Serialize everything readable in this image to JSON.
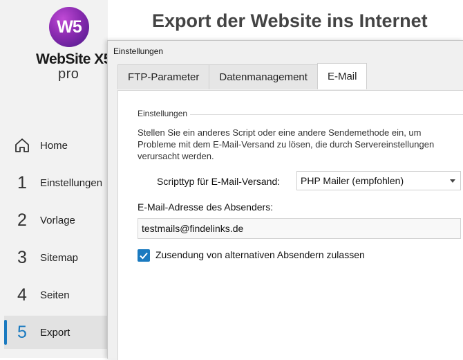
{
  "app": {
    "logo_mark": "W5",
    "logo_name": "WebSite X5",
    "logo_edition": "pro",
    "page_title": "Export der Website ins Internet",
    "accent_color": "#1a7ac0"
  },
  "sidebar": {
    "items": [
      {
        "num": "",
        "label": "Home",
        "icon": "home-icon"
      },
      {
        "num": "1",
        "label": "Einstellungen"
      },
      {
        "num": "2",
        "label": "Vorlage"
      },
      {
        "num": "3",
        "label": "Sitemap"
      },
      {
        "num": "4",
        "label": "Seiten"
      },
      {
        "num": "5",
        "label": "Export",
        "active": true
      }
    ]
  },
  "dialog": {
    "title": "Einstellungen",
    "tabs": [
      {
        "label": "FTP-Parameter"
      },
      {
        "label": "Datenmanagement"
      },
      {
        "label": "E-Mail",
        "active": true
      }
    ],
    "section_label": "Einstellungen",
    "description": "Stellen Sie ein anderes Script oder eine andere Sendemethode ein, um Probleme mit dem E-Mail-Versand zu lösen, die  durch Servereinstellungen verursacht werden.",
    "script_type_label": "Scripttyp für E-Mail-Versand:",
    "script_type_value": "PHP Mailer (empfohlen)",
    "sender_label": "E-Mail-Adresse des Absenders:",
    "sender_value": "testmails@findelinks.de",
    "alt_sender_label": "Zusendung von alternativen Absendern zulassen",
    "alt_sender_checked": true
  }
}
